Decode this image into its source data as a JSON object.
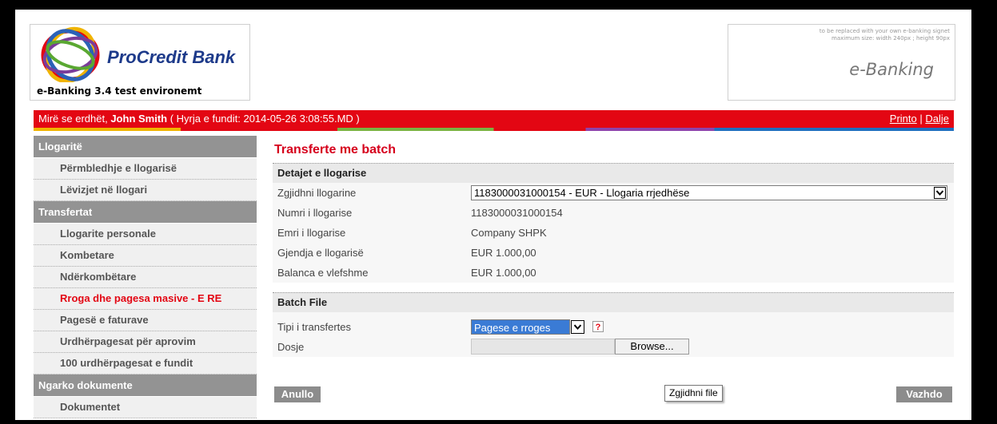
{
  "header": {
    "bank_name": "ProCredit Bank",
    "app_version": "e-Banking 3.4 test environemt",
    "signet_note": [
      "to be replaced with your own e-banking signet",
      "maximum size:  width 240px ; height 90px"
    ],
    "signet_title": "e-Banking"
  },
  "topbar": {
    "greeting": "Mirë se erdhët, ",
    "user_name": "John Smith",
    "last_login": " ( Hyrja e fundit: 2014-05-26 3:08:55.MD )",
    "print_link": "Printo",
    "separator": " | ",
    "logout_link": "Dalje"
  },
  "sidebar": {
    "sections": [
      {
        "title": "Llogaritë",
        "items": [
          "Përmbledhje e llogarisë",
          "Lëvizjet në llogari"
        ]
      },
      {
        "title": "Transfertat",
        "items": [
          "Llogarite personale",
          "Kombetare",
          "Ndërkombëtare",
          "Rroga dhe pagesa masive - E RE",
          "Pagesë e faturave",
          "Urdhërpagesat për aprovim",
          "100 urdhërpagesat e fundit"
        ]
      },
      {
        "title": "Ngarko dokumente",
        "items": [
          "Dokumentet"
        ]
      }
    ],
    "active_item": "Rroga dhe pagesa masive - E RE"
  },
  "main": {
    "title": "Transferte me batch",
    "account_section": {
      "heading": "Detajet e llogarise",
      "select_label": "Zgjidhni llogarine",
      "selected_account": "1183000031000154 - EUR - Llogaria rrjedhëse",
      "rows": [
        {
          "label": "Numri i llogarise",
          "value": "1183000031000154"
        },
        {
          "label": "Emri i llogarise",
          "value": "Company SHPK"
        },
        {
          "label": "Gjendja e llogarisë",
          "value": "EUR 1.000,00"
        },
        {
          "label": "Balanca e vlefshme",
          "value": "EUR 1.000,00"
        }
      ]
    },
    "batch_section": {
      "heading": "Batch File",
      "type_label": "Tipi i transfertes",
      "type_value": "Pagese e rroges",
      "help": "?",
      "file_label": "Dosje",
      "browse_label": "Browse..."
    },
    "cancel_label": "Anullo",
    "continue_label": "Vazhdo",
    "tooltip": "Zgjidhni file"
  },
  "colors": {
    "brand_red": "#e30613",
    "sidebar_header": "#939393",
    "select_highlight": "#3a7bd5"
  }
}
